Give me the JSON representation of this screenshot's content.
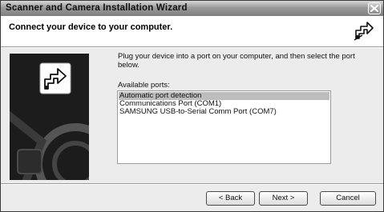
{
  "window": {
    "title": "Scanner and Camera Installation Wizard",
    "close_icon": "close-icon"
  },
  "header": {
    "title": "Connect your device to your computer.",
    "icon": "device-connect-icon"
  },
  "side_panel": {
    "image": "wizard-graphic-icon"
  },
  "main": {
    "instructions": "Plug your device into a port on your computer, and then select the port below.",
    "ports_label": "Available ports:",
    "ports": [
      {
        "label": "Automatic port detection",
        "selected": true
      },
      {
        "label": "Communications Port (COM1)",
        "selected": false
      },
      {
        "label": "SAMSUNG USB-to-Serial Comm Port (COM7)",
        "selected": false
      }
    ]
  },
  "buttons": {
    "back": "< Back",
    "next": "Next >",
    "cancel": "Cancel"
  }
}
